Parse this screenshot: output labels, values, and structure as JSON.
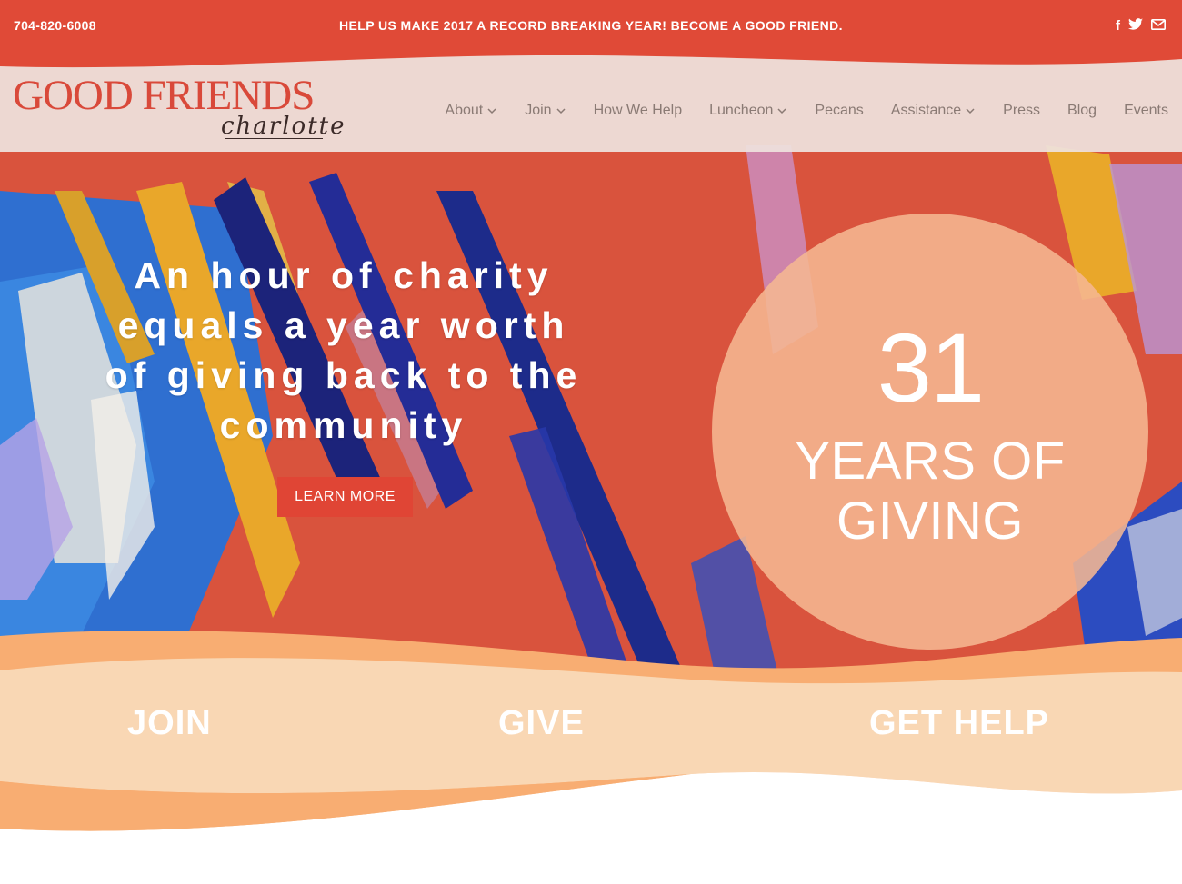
{
  "topbar": {
    "phone": "704-820-6008",
    "promo": "HELP US MAKE 2017 A RECORD BREAKING YEAR! BECOME A GOOD FRIEND.",
    "social": {
      "facebook": "f",
      "twitter_icon": "twitter-bird-icon",
      "mail_icon": "envelope-icon"
    }
  },
  "logo": {
    "main": "GOOD FRIENDS",
    "script": "charlotte"
  },
  "nav": {
    "items": [
      {
        "label": "About",
        "dropdown": true
      },
      {
        "label": "Join",
        "dropdown": true
      },
      {
        "label": "How We Help",
        "dropdown": false
      },
      {
        "label": "Luncheon",
        "dropdown": true
      },
      {
        "label": "Pecans",
        "dropdown": false
      },
      {
        "label": "Assistance",
        "dropdown": true
      },
      {
        "label": "Press",
        "dropdown": false
      },
      {
        "label": "Blog",
        "dropdown": false
      },
      {
        "label": "Events",
        "dropdown": false
      }
    ]
  },
  "hero": {
    "lines": [
      "An hour of charity",
      "equals a year worth",
      "of giving back to the",
      "community"
    ],
    "button": "LEARN MORE",
    "badge": {
      "number": "31",
      "label_line1": "YEARS OF",
      "label_line2": "GIVING"
    }
  },
  "cta": {
    "join": "JOIN",
    "give": "GIVE",
    "get_help": "GET HELP"
  },
  "colors": {
    "brand_red": "#e04a37",
    "peach": "#f5b792",
    "orange_wave": "#f8ad72",
    "light_wave": "#f9d7b4",
    "nav_text": "#8a7a74"
  }
}
